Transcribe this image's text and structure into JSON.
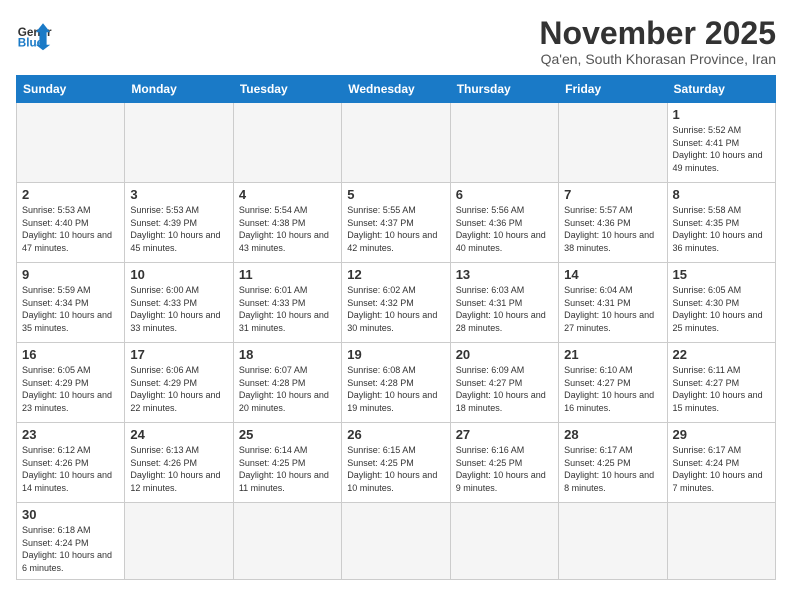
{
  "logo": {
    "text_general": "General",
    "text_blue": "Blue"
  },
  "title": "November 2025",
  "subtitle": "Qa'en, South Khorasan Province, Iran",
  "headers": [
    "Sunday",
    "Monday",
    "Tuesday",
    "Wednesday",
    "Thursday",
    "Friday",
    "Saturday"
  ],
  "weeks": [
    [
      {
        "day": "",
        "info": "",
        "empty": true
      },
      {
        "day": "",
        "info": "",
        "empty": true
      },
      {
        "day": "",
        "info": "",
        "empty": true
      },
      {
        "day": "",
        "info": "",
        "empty": true
      },
      {
        "day": "",
        "info": "",
        "empty": true
      },
      {
        "day": "",
        "info": "",
        "empty": true
      },
      {
        "day": "1",
        "info": "Sunrise: 5:52 AM\nSunset: 4:41 PM\nDaylight: 10 hours and 49 minutes."
      }
    ],
    [
      {
        "day": "2",
        "info": "Sunrise: 5:53 AM\nSunset: 4:40 PM\nDaylight: 10 hours and 47 minutes."
      },
      {
        "day": "3",
        "info": "Sunrise: 5:53 AM\nSunset: 4:39 PM\nDaylight: 10 hours and 45 minutes."
      },
      {
        "day": "4",
        "info": "Sunrise: 5:54 AM\nSunset: 4:38 PM\nDaylight: 10 hours and 43 minutes."
      },
      {
        "day": "5",
        "info": "Sunrise: 5:55 AM\nSunset: 4:37 PM\nDaylight: 10 hours and 42 minutes."
      },
      {
        "day": "6",
        "info": "Sunrise: 5:56 AM\nSunset: 4:36 PM\nDaylight: 10 hours and 40 minutes."
      },
      {
        "day": "7",
        "info": "Sunrise: 5:57 AM\nSunset: 4:36 PM\nDaylight: 10 hours and 38 minutes."
      },
      {
        "day": "8",
        "info": "Sunrise: 5:58 AM\nSunset: 4:35 PM\nDaylight: 10 hours and 36 minutes."
      }
    ],
    [
      {
        "day": "9",
        "info": "Sunrise: 5:59 AM\nSunset: 4:34 PM\nDaylight: 10 hours and 35 minutes."
      },
      {
        "day": "10",
        "info": "Sunrise: 6:00 AM\nSunset: 4:33 PM\nDaylight: 10 hours and 33 minutes."
      },
      {
        "day": "11",
        "info": "Sunrise: 6:01 AM\nSunset: 4:33 PM\nDaylight: 10 hours and 31 minutes."
      },
      {
        "day": "12",
        "info": "Sunrise: 6:02 AM\nSunset: 4:32 PM\nDaylight: 10 hours and 30 minutes."
      },
      {
        "day": "13",
        "info": "Sunrise: 6:03 AM\nSunset: 4:31 PM\nDaylight: 10 hours and 28 minutes."
      },
      {
        "day": "14",
        "info": "Sunrise: 6:04 AM\nSunset: 4:31 PM\nDaylight: 10 hours and 27 minutes."
      },
      {
        "day": "15",
        "info": "Sunrise: 6:05 AM\nSunset: 4:30 PM\nDaylight: 10 hours and 25 minutes."
      }
    ],
    [
      {
        "day": "16",
        "info": "Sunrise: 6:05 AM\nSunset: 4:29 PM\nDaylight: 10 hours and 23 minutes."
      },
      {
        "day": "17",
        "info": "Sunrise: 6:06 AM\nSunset: 4:29 PM\nDaylight: 10 hours and 22 minutes."
      },
      {
        "day": "18",
        "info": "Sunrise: 6:07 AM\nSunset: 4:28 PM\nDaylight: 10 hours and 20 minutes."
      },
      {
        "day": "19",
        "info": "Sunrise: 6:08 AM\nSunset: 4:28 PM\nDaylight: 10 hours and 19 minutes."
      },
      {
        "day": "20",
        "info": "Sunrise: 6:09 AM\nSunset: 4:27 PM\nDaylight: 10 hours and 18 minutes."
      },
      {
        "day": "21",
        "info": "Sunrise: 6:10 AM\nSunset: 4:27 PM\nDaylight: 10 hours and 16 minutes."
      },
      {
        "day": "22",
        "info": "Sunrise: 6:11 AM\nSunset: 4:27 PM\nDaylight: 10 hours and 15 minutes."
      }
    ],
    [
      {
        "day": "23",
        "info": "Sunrise: 6:12 AM\nSunset: 4:26 PM\nDaylight: 10 hours and 14 minutes."
      },
      {
        "day": "24",
        "info": "Sunrise: 6:13 AM\nSunset: 4:26 PM\nDaylight: 10 hours and 12 minutes."
      },
      {
        "day": "25",
        "info": "Sunrise: 6:14 AM\nSunset: 4:25 PM\nDaylight: 10 hours and 11 minutes."
      },
      {
        "day": "26",
        "info": "Sunrise: 6:15 AM\nSunset: 4:25 PM\nDaylight: 10 hours and 10 minutes."
      },
      {
        "day": "27",
        "info": "Sunrise: 6:16 AM\nSunset: 4:25 PM\nDaylight: 10 hours and 9 minutes."
      },
      {
        "day": "28",
        "info": "Sunrise: 6:17 AM\nSunset: 4:25 PM\nDaylight: 10 hours and 8 minutes."
      },
      {
        "day": "29",
        "info": "Sunrise: 6:17 AM\nSunset: 4:24 PM\nDaylight: 10 hours and 7 minutes."
      }
    ],
    [
      {
        "day": "30",
        "info": "Sunrise: 6:18 AM\nSunset: 4:24 PM\nDaylight: 10 hours and 6 minutes.",
        "last": true
      },
      {
        "day": "",
        "info": "",
        "empty": true,
        "last": true
      },
      {
        "day": "",
        "info": "",
        "empty": true,
        "last": true
      },
      {
        "day": "",
        "info": "",
        "empty": true,
        "last": true
      },
      {
        "day": "",
        "info": "",
        "empty": true,
        "last": true
      },
      {
        "day": "",
        "info": "",
        "empty": true,
        "last": true
      },
      {
        "day": "",
        "info": "",
        "empty": true,
        "last": true
      }
    ]
  ]
}
